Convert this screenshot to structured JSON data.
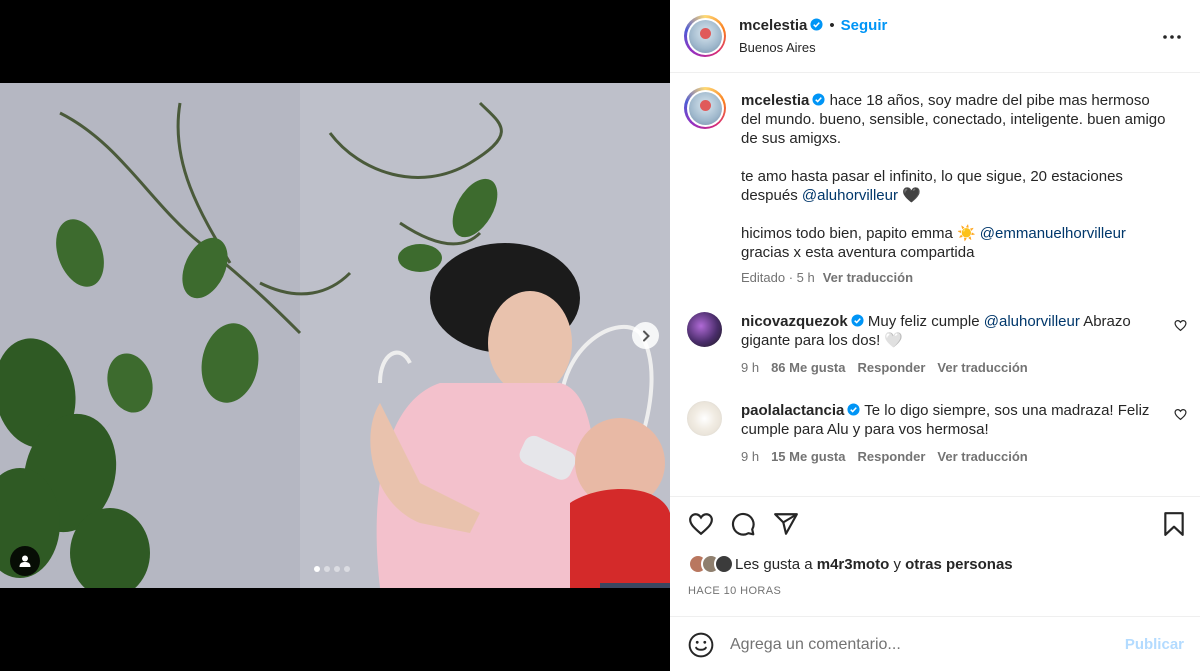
{
  "post": {
    "username": "mcelestia",
    "follow_label": "Seguir",
    "separator": "•",
    "location": "Buenos Aires",
    "carousel": {
      "slide_count": 4,
      "active_slide": 1
    }
  },
  "caption": {
    "username": "mcelestia",
    "line1": "hace 18 años, soy madre del pibe mas hermoso del mundo. bueno, sensible, conectado, inteligente. buen amigo de sus amigxs.",
    "line2_text": "te amo hasta pasar el infinito, lo que sigue, 20 estaciones después ",
    "line2_mention": "@aluhorvilleur",
    "line2_suffix": " 🖤",
    "line3_text": "hicimos todo bien, papito emma ☀️ ",
    "line3_mention": "@emmanuelhorvilleur",
    "line3_after": "gracias x esta aventura compartida",
    "edited": "Editado · 5 h",
    "translate": "Ver traducción"
  },
  "comments": [
    {
      "username": "nicovazquezok",
      "text_before": "Muy feliz cumple ",
      "mention": "@aluhorvilleur",
      "text_after": " Abrazo gigante para los dos! 🤍",
      "time": "9 h",
      "likes": "86 Me gusta",
      "reply": "Responder",
      "translate": "Ver traducción"
    },
    {
      "username": "paolalactancia",
      "text_before": "Te lo digo siempre, sos una madraza! Feliz cumple para Alu y para vos hermosa!",
      "mention": "",
      "text_after": "",
      "time": "9 h",
      "likes": "15 Me gusta",
      "reply": "Responder",
      "translate": "Ver traducción"
    }
  ],
  "likes_line": {
    "prefix": "Les gusta a ",
    "user": "m4r3moto",
    "middle": " y ",
    "others": "otras personas"
  },
  "time_ago": "HACE 10 HORAS",
  "add_comment": {
    "placeholder": "Agrega un comentario...",
    "publish_label": "Publicar"
  },
  "colors": {
    "link_blue": "#0095f6",
    "mention_blue": "#00376b",
    "muted": "#737373",
    "publish_disabled": "#b3dbff"
  },
  "icons": [
    "verified-icon",
    "more-icon",
    "chevron-right-icon",
    "user-tag-icon",
    "heart-icon",
    "comment-icon",
    "share-icon",
    "bookmark-icon",
    "emoji-icon"
  ]
}
